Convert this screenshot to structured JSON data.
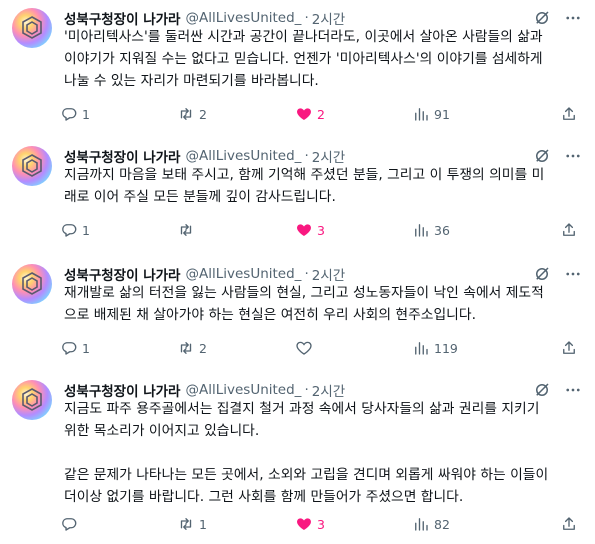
{
  "tweets": [
    {
      "name": "성북구청장이 나가라",
      "handle": "@AllLivesUnited_",
      "dot": "·",
      "time": "2시간",
      "lines": [
        "'미아리텍사스'를 둘러싼 시간과 공간이 끝나더라도, 이곳에서 살아온 사람들의 삶과",
        "이야기가 지워질 수는 없다고 믿습니다. 언젠가 '미아리텍사스'의 이야기를 섬세하게",
        "나눌 수 있는 자리가 마련되기를 바라봅니다."
      ],
      "replies": "1",
      "retweets": "2",
      "likes": "2",
      "views": "91"
    },
    {
      "name": "성북구청장이 나가라",
      "handle": "@AllLivesUnited_",
      "dot": "·",
      "time": "2시간",
      "lines": [
        "지금까지 마음을 보태 주시고, 함께 기억해 주셨던 분들, 그리고 이 투쟁의 의미를 미",
        "래로 이어 주실 모든 분들께 깊이 감사드립니다."
      ],
      "replies": "1",
      "retweets": "",
      "likes": "3",
      "views": "36"
    },
    {
      "name": "성북구청장이 나가라",
      "handle": "@AllLivesUnited_",
      "dot": "·",
      "time": "2시간",
      "lines": [
        "재개발로 삶의 터전을 잃는 사람들의 현실, 그리고 성노동자들이 낙인 속에서 제도적",
        "으로 배제된 채 살아가야 하는 현실은 여전히 우리 사회의 현주소입니다."
      ],
      "replies": "1",
      "retweets": "2",
      "likes": "",
      "views": "119"
    },
    {
      "name": "성북구청장이 나가라",
      "handle": "@AllLivesUnited_",
      "dot": "·",
      "time": "2시간",
      "lines": [
        "지금도 파주 용주골에서는 집결지 철거 과정 속에서 당사자들의 삶과 권리를 지키기",
        "위한 목소리가 이어지고 있습니다."
      ],
      "lines2": [
        "같은 문제가 나타나는 모든 곳에서, 소외와 고립을 견디며 외롭게 싸워야 하는 이들이",
        "더이상 없기를 바랍니다. 그런 사회를 함께 만들어가 주셨으면 합니다."
      ],
      "replies": "",
      "retweets": "1",
      "likes": "3",
      "views": "82"
    }
  ],
  "icons": {
    "avatar": "rainbow-avatar",
    "grok": "grok-icon",
    "more": "more-icon",
    "reply": "reply-icon",
    "retweet": "retweet-icon",
    "like": "heart-icon",
    "views": "views-icon",
    "share": "share-icon"
  },
  "colors": {
    "text": "#0f1419",
    "secondary": "#536471",
    "like_active": "#f91880"
  }
}
